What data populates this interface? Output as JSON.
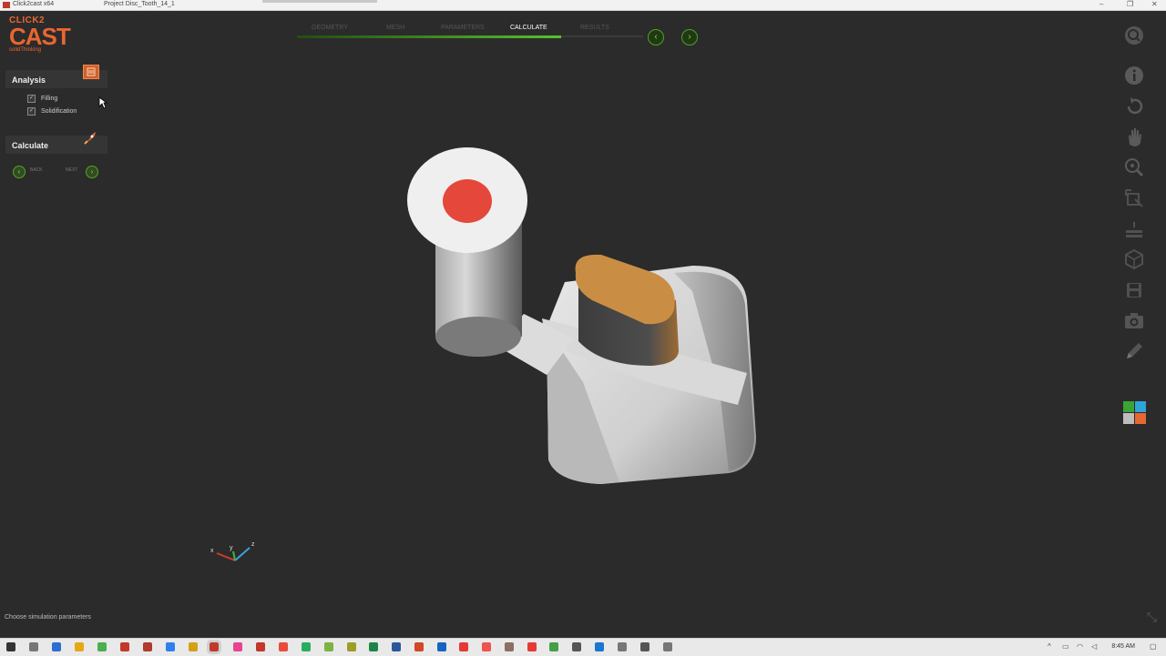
{
  "window": {
    "app_title": "Click2cast x64",
    "project_title": "Project Disc_Tooth_14_1"
  },
  "logo": {
    "line1": "CLICK2",
    "line2": "CAST",
    "line3": "solidThinking"
  },
  "steps": [
    {
      "label": "GEOMETRY",
      "active": false
    },
    {
      "label": "MESH",
      "active": false
    },
    {
      "label": "PARAMETERS",
      "active": false
    },
    {
      "label": "CALCULATE",
      "active": true
    },
    {
      "label": "RESULTS",
      "active": false
    }
  ],
  "analysis": {
    "title": "Analysis",
    "options": [
      {
        "label": "Filling",
        "checked": true
      },
      {
        "label": "Solidification",
        "checked": true
      }
    ]
  },
  "calculate": {
    "title": "Calculate"
  },
  "nav": {
    "back_label": "BACK",
    "next_label": "NEXT"
  },
  "axis": {
    "x": "x",
    "y": "y",
    "z": "z"
  },
  "status": {
    "text": "Choose simulation parameters"
  },
  "toolbar_icons": [
    "search-icon",
    "info-icon",
    "undo-icon",
    "pan-hand-icon",
    "zoom-icon",
    "fit-view-icon",
    "section-plane-icon",
    "cube-view-icon",
    "save-icon",
    "camera-icon",
    "pencil-icon"
  ],
  "taskbar": {
    "clock": "8:45 AM"
  },
  "colors": {
    "accent": "#e8662f",
    "nav_green": "#5aa02c",
    "active_fill": "#58c12e"
  }
}
